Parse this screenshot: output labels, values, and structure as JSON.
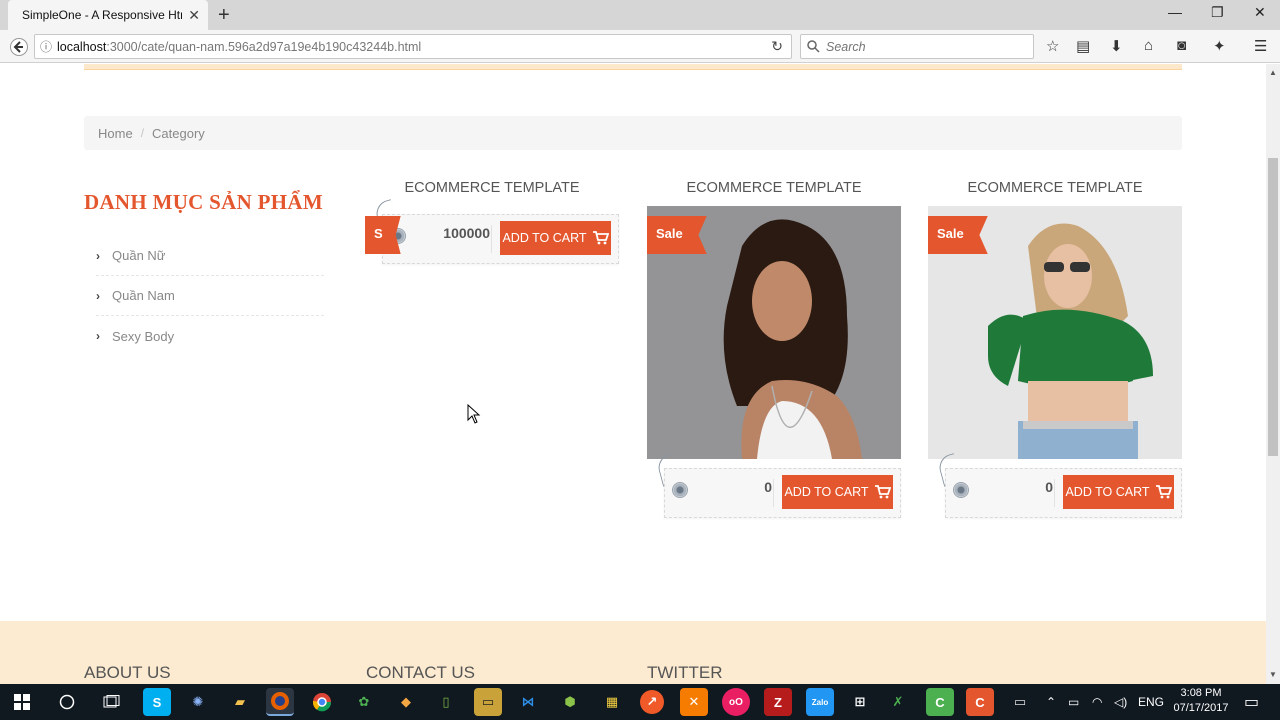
{
  "browser": {
    "tab_title": "SimpleOne - A Responsive Html",
    "url_host": "localhost",
    "url_path": ":3000/cate/quan-nam.596a2d97a19e4b190c43244b.html",
    "search_placeholder": "Search"
  },
  "breadcrumb": {
    "home": "Home",
    "separator": "/",
    "current": "Category"
  },
  "sidebar": {
    "title": "DANH MỤC SẢN PHẨM",
    "items": [
      {
        "label": "Quần Nữ"
      },
      {
        "label": "Quần Nam"
      },
      {
        "label": "Sexy Body"
      }
    ]
  },
  "products": [
    {
      "title": "ECOMMERCE TEMPLATE",
      "price": "100000",
      "sale": "S",
      "cart_label": "ADD TO CART",
      "has_image": false
    },
    {
      "title": "ECOMMERCE TEMPLATE",
      "price": "0",
      "sale": "Sale",
      "cart_label": "ADD TO CART",
      "has_image": true
    },
    {
      "title": "ECOMMERCE TEMPLATE",
      "price": "0",
      "sale": "Sale",
      "cart_label": "ADD TO CART",
      "has_image": true
    }
  ],
  "footer": {
    "about": "ABOUT US",
    "contact": "CONTACT US",
    "twitter": "TWITTER"
  },
  "taskbar": {
    "language": "ENG",
    "time": "3:08 PM",
    "date": "07/17/2017"
  },
  "colors": {
    "accent": "#e4572e",
    "footer_bg": "#fcebd1",
    "taskbar_bg": "#101820"
  }
}
